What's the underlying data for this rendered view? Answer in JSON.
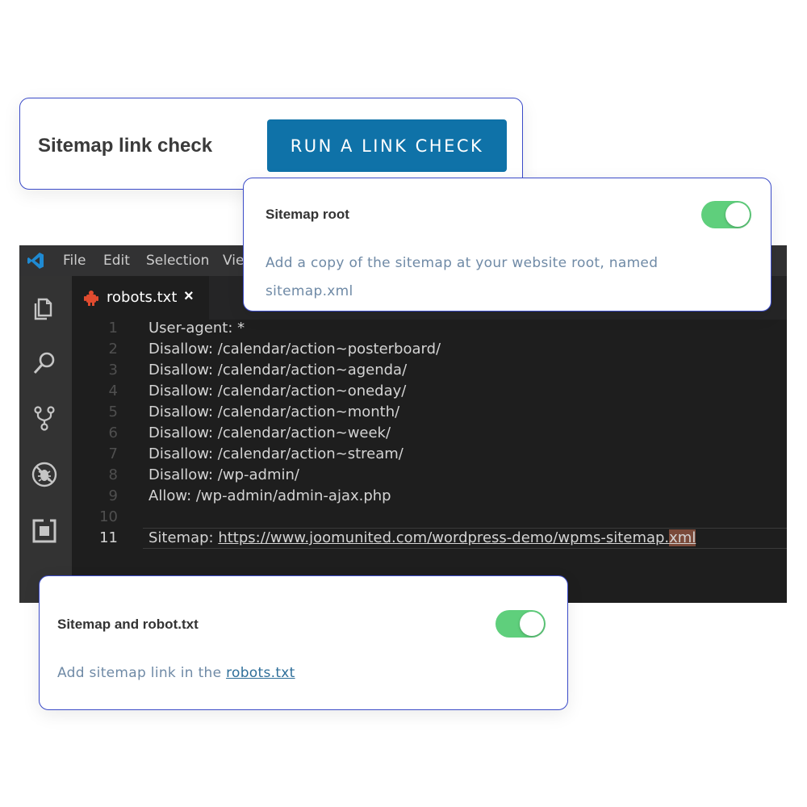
{
  "link_check": {
    "title": "Sitemap link check",
    "button_label": "RUN A LINK CHECK"
  },
  "sitemap_root": {
    "title": "Sitemap root",
    "description": "Add a copy of the sitemap at your website root, named sitemap.xml",
    "toggle_on": true
  },
  "editor": {
    "menu": [
      "File",
      "Edit",
      "Selection",
      "Vie"
    ],
    "tab_label": "robots.txt",
    "tab_close": "×",
    "lines": [
      {
        "num": "1",
        "text": "User-agent: *"
      },
      {
        "num": "2",
        "text": "Disallow: /calendar/action~posterboard/"
      },
      {
        "num": "3",
        "text": "Disallow: /calendar/action~agenda/"
      },
      {
        "num": "4",
        "text": "Disallow: /calendar/action~oneday/"
      },
      {
        "num": "5",
        "text": "Disallow: /calendar/action~month/"
      },
      {
        "num": "6",
        "text": "Disallow: /calendar/action~week/"
      },
      {
        "num": "7",
        "text": "Disallow: /calendar/action~stream/"
      },
      {
        "num": "8",
        "text": "Disallow: /wp-admin/"
      },
      {
        "num": "9",
        "text": "Allow: /wp-admin/admin-ajax.php"
      },
      {
        "num": "10",
        "text": ""
      }
    ],
    "sitemap_line": {
      "num": "11",
      "prefix": "Sitemap: ",
      "url_main": "https://www.joomunited.com/wordpress-demo/wpms-sitemap.",
      "url_highlight": "xml"
    },
    "icons": [
      "files-icon",
      "search-icon",
      "source-control-icon",
      "debug-icon",
      "extensions-icon"
    ]
  },
  "sitemap_robots": {
    "title": "Sitemap and robot.txt",
    "description_prefix": "Add sitemap link in the ",
    "link_text": "robots.txt",
    "toggle_on": true
  },
  "colors": {
    "accent_button": "#0f72a8",
    "toggle_on": "#5fcf7c",
    "card_border": "#3b4bc8"
  }
}
